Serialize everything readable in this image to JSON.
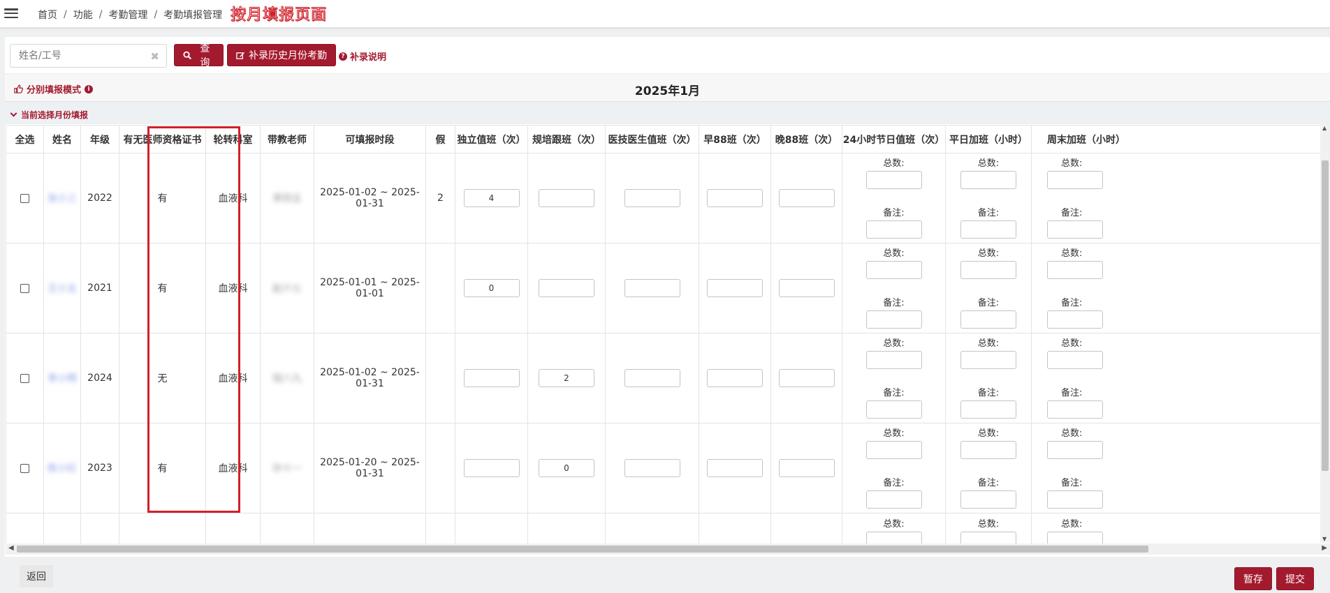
{
  "breadcrumb": [
    "首页",
    "功能",
    "考勤管理",
    "考勤填报管理"
  ],
  "annotation_title": "按月填报页面",
  "search": {
    "placeholder": "姓名/工号",
    "clear_glyph": "✖"
  },
  "buttons": {
    "query": "查询",
    "supplement": "补录历史月份考勤",
    "help": "补录说明",
    "back": "返回",
    "save": "暂存",
    "submit": "提交"
  },
  "mode": {
    "label": "分别填报模式"
  },
  "month_title": "2025年1月",
  "current_label": "当前选择月份填报",
  "columns": [
    "全选",
    "姓名",
    "年级",
    "有无医师资格证书",
    "轮转科室",
    "带教老师",
    "可填报时段",
    "假",
    "独立值班（次）",
    "规培跟班（次）",
    "医技医生值班（次）",
    "早88班（次）",
    "晚88班（次）",
    "24小时节日值班（次）",
    "平日加班（小时）",
    "周末加班（小时）"
  ],
  "labels": {
    "total": "总数:",
    "remark": "备注:"
  },
  "rows": [
    {
      "name": "张小三",
      "grade": "2022",
      "cert": "有",
      "dept": "血液科",
      "teacher": "李四五",
      "period": "2025-01-02 ~ 2025-01-31",
      "leave": "2",
      "independent": "4",
      "follow": "",
      "tech": "",
      "early": "",
      "late": ""
    },
    {
      "name": "王小五",
      "grade": "2021",
      "cert": "有",
      "dept": "血液科",
      "teacher": "赵六七",
      "period": "2025-01-01 ~ 2025-01-01",
      "leave": "",
      "independent": "0",
      "follow": "",
      "tech": "",
      "early": "",
      "late": ""
    },
    {
      "name": "李小明",
      "grade": "2024",
      "cert": "无",
      "dept": "血液科",
      "teacher": "钱八九",
      "period": "2025-01-02 ~ 2025-01-31",
      "leave": "",
      "independent": "",
      "follow": "2",
      "tech": "",
      "early": "",
      "late": ""
    },
    {
      "name": "陈小红",
      "grade": "2023",
      "cert": "有",
      "dept": "血液科",
      "teacher": "孙十一",
      "period": "2025-01-20 ~ 2025-01-31",
      "leave": "",
      "independent": "",
      "follow": "0",
      "tech": "",
      "early": "",
      "late": ""
    }
  ],
  "colors": {
    "accent": "#a31a2e",
    "highlight": "#d0202a"
  }
}
